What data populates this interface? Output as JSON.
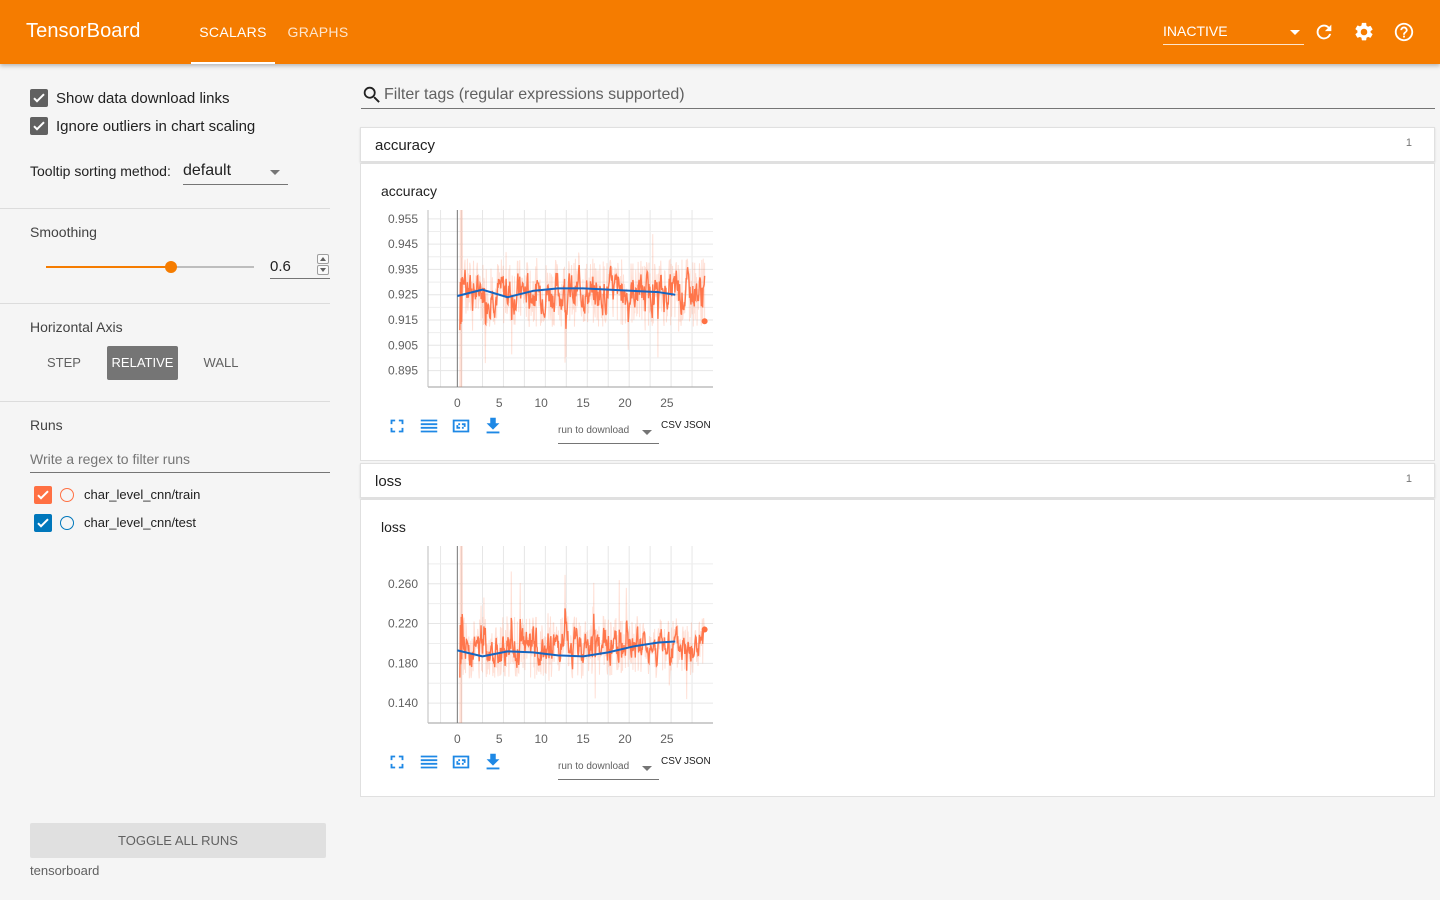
{
  "header": {
    "brand": "TensorBoard",
    "tabs": [
      {
        "label": "SCALARS"
      },
      {
        "label": "GRAPHS"
      }
    ],
    "status": "INACTIVE",
    "accent_color": "#f57c00"
  },
  "sidebar": {
    "show_download_links": "Show data download links",
    "ignore_outliers": "Ignore outliers in chart scaling",
    "tooltip_label": "Tooltip sorting method:",
    "tooltip_value": "default",
    "smoothing_title": "Smoothing",
    "smoothing_value": "0.6",
    "smoothing_fraction": 0.6,
    "horizontal_axis_title": "Horizontal Axis",
    "axis_options": [
      "STEP",
      "RELATIVE",
      "WALL"
    ],
    "axis_selected": "RELATIVE",
    "runs_title": "Runs",
    "runs_filter_placeholder": "Write a regex to filter runs",
    "runs": [
      {
        "name": "char_level_cnn/train",
        "color": "#ff7043"
      },
      {
        "name": "char_level_cnn/test",
        "color": "#0077bb"
      }
    ],
    "toggle_all": "TOGGLE ALL RUNS",
    "footer": "tensorboard"
  },
  "main": {
    "filter_placeholder": "Filter tags (regular expressions supported)",
    "download_select": "run to download",
    "csv": "CSV",
    "json": "JSON",
    "categories": [
      {
        "name": "accuracy",
        "count": "1",
        "card_title": "accuracy"
      },
      {
        "name": "loss",
        "count": "1",
        "card_title": "loss"
      }
    ]
  },
  "chart_data": [
    {
      "type": "line",
      "title": "accuracy",
      "x_ticks": [
        "0",
        "5",
        "10",
        "15",
        "20",
        "25"
      ],
      "y_ticks": [
        "0.955",
        "0.945",
        "0.935",
        "0.925",
        "0.915",
        "0.905",
        "0.895"
      ],
      "xlim": [
        -3.5,
        30.5
      ],
      "ylim": [
        0.8885,
        0.9585
      ],
      "series": [
        {
          "name": "char_level_cnn/train",
          "color": "#ff7043",
          "x_range": [
            0.3,
            29.5
          ],
          "mean": 0.926,
          "spread": 0.013,
          "raw_min": 0.8885,
          "raw_max": 0.9585,
          "last": 0.9145,
          "seed": 7
        },
        {
          "name": "char_level_cnn/test",
          "color": "#1565c0",
          "x": [
            0,
            3,
            6,
            9,
            12,
            15,
            18,
            21,
            24,
            26
          ],
          "y": [
            0.9245,
            0.927,
            0.924,
            0.9265,
            0.9275,
            0.9275,
            0.927,
            0.9265,
            0.926,
            0.925
          ]
        }
      ]
    },
    {
      "type": "line",
      "title": "loss",
      "x_ticks": [
        "0",
        "5",
        "10",
        "15",
        "20",
        "25"
      ],
      "y_ticks": [
        "0.260",
        "0.220",
        "0.180",
        "0.140"
      ],
      "xlim": [
        -3.5,
        30.5
      ],
      "ylim": [
        0.12,
        0.298
      ],
      "series": [
        {
          "name": "char_level_cnn/train",
          "color": "#ff7043",
          "x_range": [
            0.3,
            29.5
          ],
          "mean": 0.196,
          "spread": 0.03,
          "raw_min": 0.12,
          "raw_max": 0.298,
          "last": 0.214,
          "seed": 13
        },
        {
          "name": "char_level_cnn/test",
          "color": "#1565c0",
          "x": [
            0,
            3,
            6,
            9,
            12,
            15,
            18,
            21,
            24,
            26
          ],
          "y": [
            0.193,
            0.187,
            0.192,
            0.191,
            0.188,
            0.187,
            0.191,
            0.197,
            0.201,
            0.202
          ]
        }
      ]
    }
  ]
}
